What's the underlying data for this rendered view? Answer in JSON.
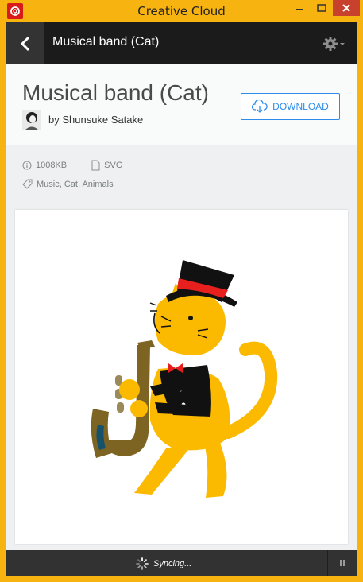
{
  "window": {
    "title": "Creative Cloud"
  },
  "header": {
    "title": "Musical band (Cat)"
  },
  "asset": {
    "title": "Musical band (Cat)",
    "author": "by Shunsuke Satake",
    "download_label": "DOWNLOAD",
    "size": "1008KB",
    "format": "SVG",
    "tags": "Music, Cat, Animals"
  },
  "status": {
    "text": "Syncing..."
  },
  "icons": {
    "app": "creative-cloud-icon",
    "back": "chevron-left-icon",
    "settings": "gear-icon",
    "download": "cloud-download-icon",
    "size": "info-icon",
    "format": "file-icon",
    "tags": "tag-icon",
    "sync": "spinner-icon",
    "pause": "pause-icon"
  },
  "colors": {
    "accent": "#2d8ceb",
    "window_frame": "#f7b30f",
    "close_button": "#c7412d",
    "header_bg": "#1b1b1b"
  }
}
